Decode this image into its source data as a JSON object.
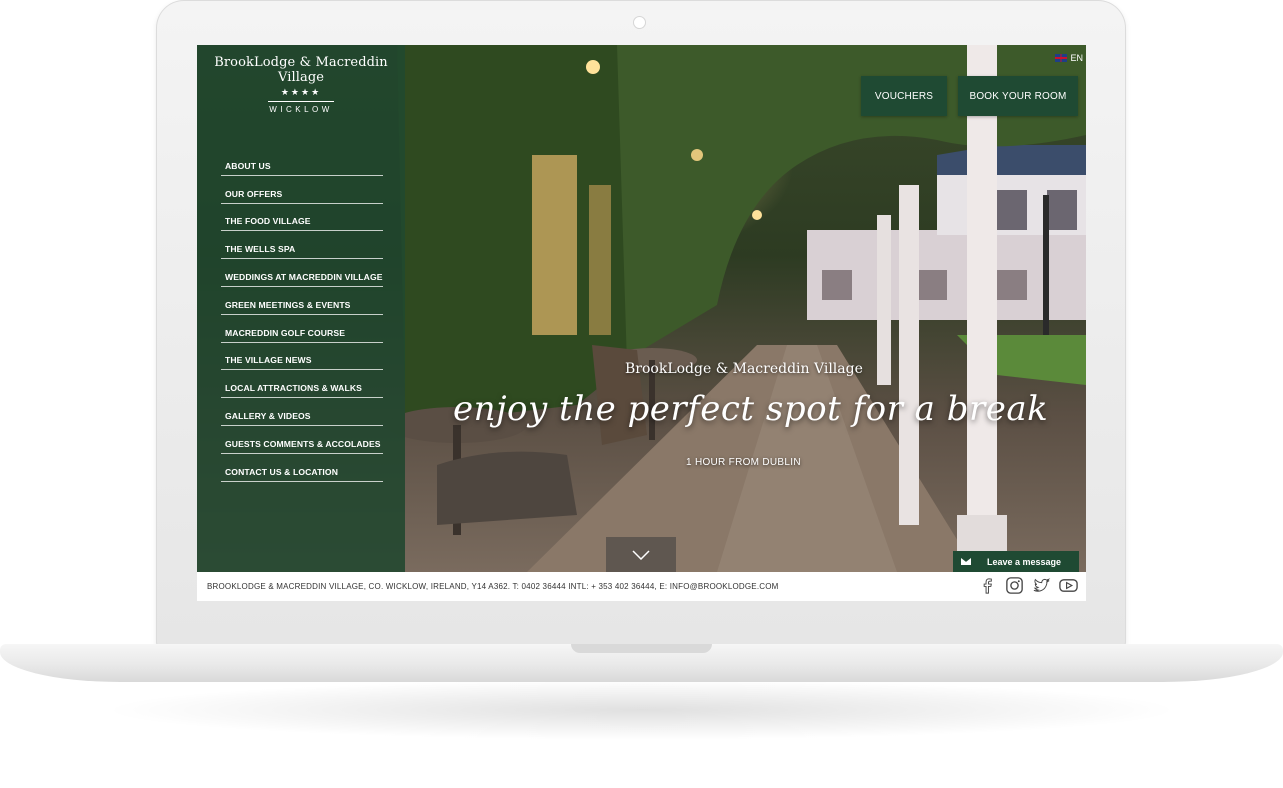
{
  "site": {
    "logo_name": "BrookLodge & Macreddin Village",
    "logo_stars": "★★★★",
    "logo_region": "WICKLOW"
  },
  "nav": {
    "items": [
      "ABOUT US",
      "OUR OFFERS",
      "THE FOOD VILLAGE",
      "THE WELLS SPA",
      "WEDDINGS AT MACREDDIN VILLAGE",
      "GREEN MEETINGS & EVENTS",
      "MACREDDIN GOLF COURSE",
      "THE VILLAGE NEWS",
      "LOCAL ATTRACTIONS & WALKS",
      "GALLERY & VIDEOS",
      "GUESTS COMMENTS & ACCOLADES",
      "CONTACT US & LOCATION"
    ]
  },
  "header": {
    "language": "EN",
    "vouchers_label": "VOUCHERS",
    "book_label": "BOOK YOUR ROOM"
  },
  "hero": {
    "eyebrow": "BrookLodge & Macreddin Village",
    "tagline": "enjoy the perfect spot for a break",
    "sub": "1 HOUR FROM DUBLIN"
  },
  "chat": {
    "label": "Leave a message"
  },
  "footer": {
    "address": "BROOKLODGE & MACREDDIN VILLAGE, CO. WICKLOW, IRELAND, Y14 A362.  T: 0402 36444 INTL: + 353 402 36444, E: INFO@BROOKLODGE.COM",
    "socials": [
      "facebook-icon",
      "instagram-icon",
      "twitter-icon",
      "youtube-icon"
    ]
  },
  "colors": {
    "brand_green": "#1f4a33",
    "sidebar_green": "#1e462d",
    "text_light": "#ffffff"
  }
}
